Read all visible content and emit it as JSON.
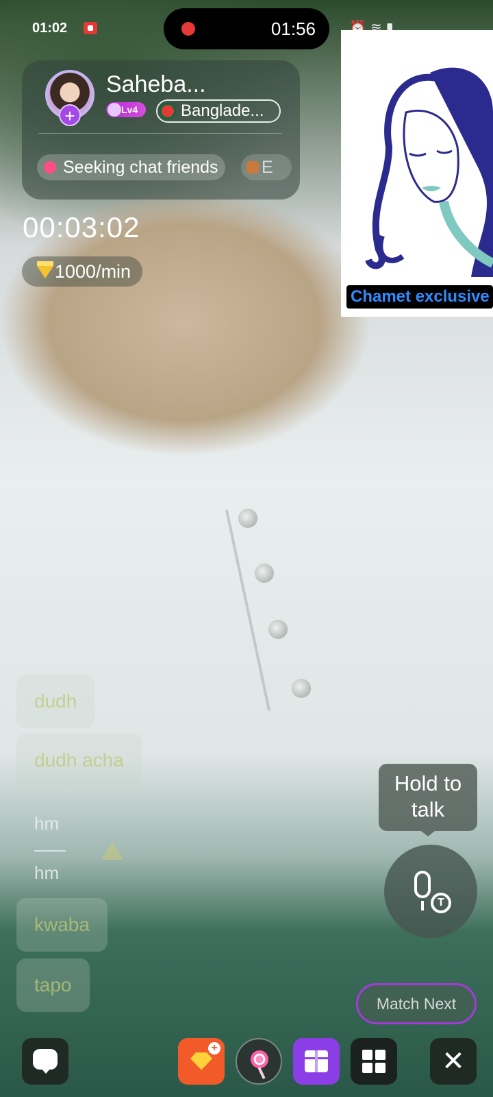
{
  "status_bar": {
    "time": "01:02",
    "recording_time": "01:56",
    "icons": [
      "alarm-icon",
      "wifi-icon",
      "call-icon",
      "signal-icon",
      "battery-icon"
    ]
  },
  "profile": {
    "name": "Saheba...",
    "level": "Lv4",
    "country": "Banglade...",
    "tags": [
      "Seeking chat friends",
      "E"
    ]
  },
  "call": {
    "timer": "00:03:02",
    "rate": "1000/min"
  },
  "ad": {
    "label": "Chamet exclusive"
  },
  "chat": {
    "messages": [
      "dudh",
      "dudh acha",
      "hm",
      "hm",
      "kwaba",
      "tapo"
    ]
  },
  "controls": {
    "hold_to_talk": "Hold to talk",
    "match_next": "Match Next"
  },
  "colors": {
    "accent_purple": "#8b3ee6",
    "record_red": "#e53935",
    "ad_text_blue": "#2e8cff",
    "coins_orange": "#f25a2a"
  }
}
